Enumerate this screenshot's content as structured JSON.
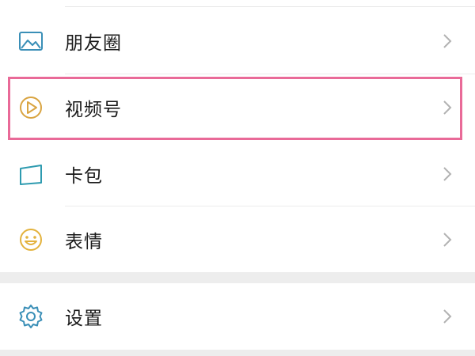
{
  "menu": {
    "items": [
      {
        "label": "朋友圈",
        "icon": "photo-album-icon"
      },
      {
        "label": "视频号",
        "icon": "play-circle-icon"
      },
      {
        "label": "卡包",
        "icon": "card-wallet-icon"
      },
      {
        "label": "表情",
        "icon": "smiley-face-icon"
      },
      {
        "label": "设置",
        "icon": "gear-icon"
      }
    ]
  },
  "colors": {
    "album_icon": "#3a8fb7",
    "play_icon": "#d9a441",
    "card_icon": "#2e9bb0",
    "smiley_icon": "#e3b23c",
    "gear_icon": "#3a8fb7",
    "highlight_border": "#e96a98",
    "chevron": "#b2b2b2",
    "separator_gap": "#ededed"
  }
}
